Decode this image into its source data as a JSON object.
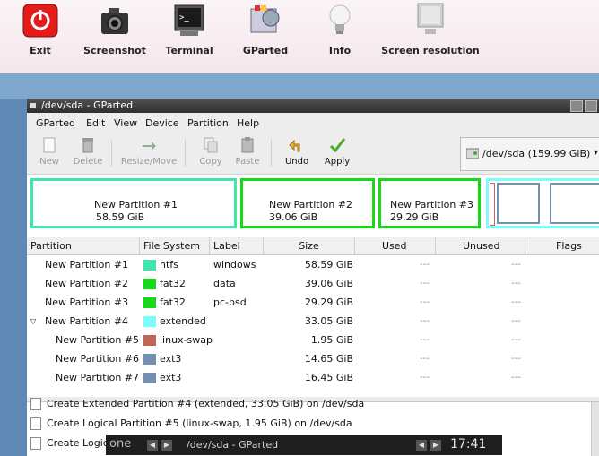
{
  "desktop": {
    "launchers": [
      {
        "label": "Exit",
        "icon": "power-icon"
      },
      {
        "label": "Screenshot",
        "icon": "camera-icon"
      },
      {
        "label": "Terminal",
        "icon": "terminal-icon"
      },
      {
        "label": "GParted",
        "icon": "gparted-icon"
      },
      {
        "label": "Info",
        "icon": "lightbulb-icon"
      },
      {
        "label": "Screen resolution",
        "icon": "monitor-icon"
      }
    ]
  },
  "window": {
    "title": "/dev/sda - GParted",
    "menu": [
      "GParted",
      "Edit",
      "View",
      "Device",
      "Partition",
      "Help"
    ],
    "toolbar": {
      "new": "New",
      "delete": "Delete",
      "resize_move": "Resize/Move",
      "copy": "Copy",
      "paste": "Paste",
      "undo": "Undo",
      "apply": "Apply"
    },
    "device_selector": "/dev/sda  (159.99 GiB)",
    "partition_map": [
      {
        "name": "New Partition #1",
        "size": "58.59 GiB"
      },
      {
        "name": "New Partition #2",
        "size": "39.06 GiB"
      },
      {
        "name": "New Partition #3",
        "size": "29.29 GiB"
      }
    ],
    "columns": [
      "Partition",
      "File System",
      "Label",
      "Size",
      "Used",
      "Unused",
      "Flags"
    ],
    "rows": [
      {
        "partition": "New Partition #1",
        "fs": "ntfs",
        "label": "windows",
        "size": "58.59 GiB",
        "used": "---",
        "unused": "---"
      },
      {
        "partition": "New Partition #2",
        "fs": "fat32",
        "label": "data",
        "size": "39.06 GiB",
        "used": "---",
        "unused": "---"
      },
      {
        "partition": "New Partition #3",
        "fs": "fat32",
        "label": "pc-bsd",
        "size": "29.29 GiB",
        "used": "---",
        "unused": "---"
      },
      {
        "partition": "New Partition #4",
        "fs": "extended",
        "label": "",
        "size": "33.05 GiB",
        "used": "---",
        "unused": "---"
      },
      {
        "partition": "New Partition #5",
        "fs": "linux-swap",
        "label": "",
        "size": "1.95 GiB",
        "used": "---",
        "unused": "---"
      },
      {
        "partition": "New Partition #6",
        "fs": "ext3",
        "label": "",
        "size": "14.65 GiB",
        "used": "---",
        "unused": "---"
      },
      {
        "partition": "New Partition #7",
        "fs": "ext3",
        "label": "",
        "size": "16.45 GiB",
        "used": "---",
        "unused": "---"
      }
    ],
    "fs_colors": {
      "ntfs": "#42e5ac",
      "fat32": "#18d918",
      "extended": "#7dfcfe",
      "linux-swap": "#c1665a",
      "ext3": "#7590ae"
    },
    "operations": [
      "Create Extended Partition #4 (extended, 33.05 GiB) on /dev/sda",
      "Create Logical Partition #5 (linux-swap, 1.95 GiB) on /dev/sda",
      "Create Logic"
    ]
  },
  "taskbar": {
    "workspace": "one",
    "task": "/dev/sda - GParted",
    "clock": "17:41"
  }
}
